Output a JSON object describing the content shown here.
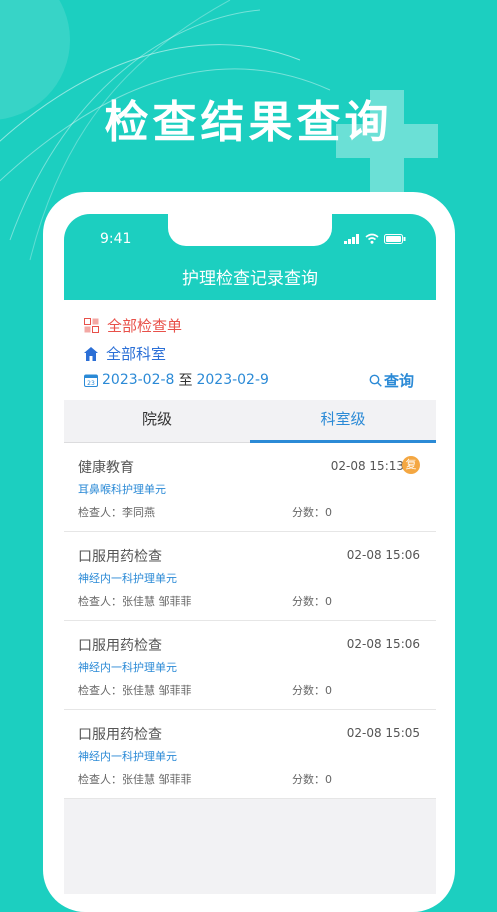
{
  "hero": {
    "title": "检查结果查询"
  },
  "status_bar": {
    "time": "9:41"
  },
  "nav": {
    "title": "护理检查记录查询"
  },
  "filters": {
    "checklist_label": "全部检查单",
    "department_label": "全部科室",
    "date_from": "2023-02-8",
    "date_sep": "至",
    "date_to": "2023-02-9",
    "query_label": "查询"
  },
  "tabs": [
    {
      "label": "院级",
      "active": false
    },
    {
      "label": "科室级",
      "active": true
    }
  ],
  "records": [
    {
      "title": "健康教育",
      "time": "02-08 15:13",
      "badge": "复",
      "dept": "耳鼻喉科护理单元",
      "inspector": "检查人：李同燕",
      "score": "分数：0"
    },
    {
      "title": "口服用药检查",
      "time": "02-08 15:06",
      "badge": "",
      "dept": "神经内一科护理单元",
      "inspector": "检查人：张佳慧 邹菲菲",
      "score": "分数：0"
    },
    {
      "title": "口服用药检查",
      "time": "02-08 15:06",
      "badge": "",
      "dept": "神经内一科护理单元",
      "inspector": "检查人：张佳慧 邹菲菲",
      "score": "分数：0"
    },
    {
      "title": "口服用药检查",
      "time": "02-08 15:05",
      "badge": "",
      "dept": "神经内一科护理单元",
      "inspector": "检查人：张佳慧 邹菲菲",
      "score": "分数：0"
    }
  ],
  "colors": {
    "accent": "#1ccfc0",
    "link": "#2b8ad6",
    "checklist": "#e8514a",
    "badge": "#f4a742"
  }
}
